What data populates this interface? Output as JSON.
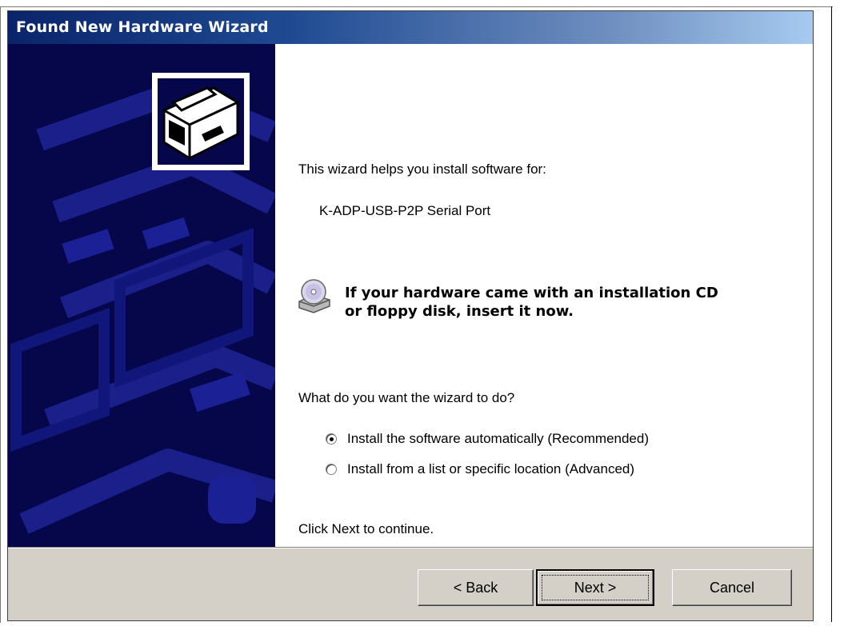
{
  "window": {
    "title": "Found New Hardware Wizard"
  },
  "content": {
    "intro": "This wizard helps you install software for:",
    "device_name": "K-ADP-USB-P2P Serial Port",
    "cd_message_line1": "If your hardware came with an installation CD",
    "cd_message_line2": "or floppy disk, insert it now.",
    "question": "What do you want the wizard to do?",
    "options": [
      {
        "label": "Install the software automatically (Recommended)",
        "selected": true
      },
      {
        "label": "Install from a list or specific location (Advanced)",
        "selected": false
      }
    ],
    "continue_hint": "Click Next to continue."
  },
  "buttons": {
    "back": "< Back",
    "next": "Next >",
    "cancel": "Cancel"
  },
  "colors": {
    "title_gradient_start": "#0a246a",
    "title_gradient_end": "#a6caf0",
    "side_panel": "#06064a",
    "dialog_face": "#d4d0c8"
  },
  "icons": [
    "hardware-card-icon",
    "cd-drive-icon"
  ]
}
